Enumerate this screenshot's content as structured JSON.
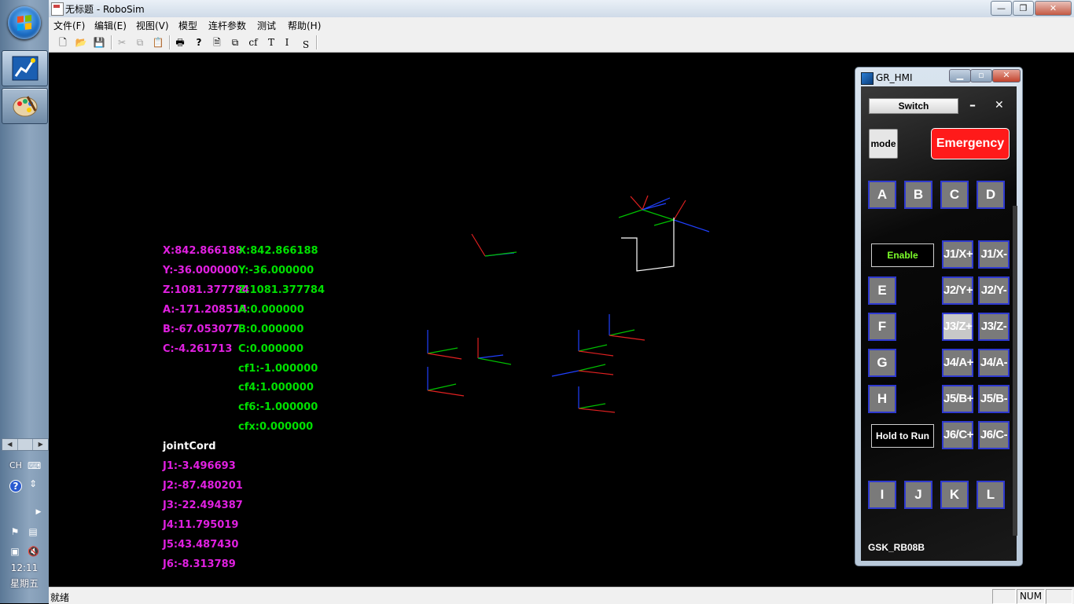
{
  "window": {
    "title": "无标题 - RoboSim",
    "controls": [
      "—",
      "❐",
      "✕"
    ]
  },
  "menu": [
    "文件(F)",
    "编辑(E)",
    "视图(V)",
    "模型",
    "连杆参数",
    "测试",
    "帮助(H)"
  ],
  "toolbar": {
    "new": "🗋",
    "open": "📂",
    "save": "💾",
    "cut": "✂",
    "copy": "⧉",
    "paste": "📋",
    "print": "🖶",
    "help": "?",
    "page": "🗎",
    "window": "⧉",
    "cf": "cf",
    "t": "T",
    "i": "I",
    "s": "S"
  },
  "viewport": {
    "cartesian_left": {
      "x": "X:842.866188",
      "y": "Y:-36.000000",
      "z": "Z:1081.377784",
      "a": "A:-171.208514",
      "b": "B:-67.053077",
      "c": "C:-4.261713"
    },
    "cartesian_right": {
      "x": "X:842.866188",
      "y": "Y:-36.000000",
      "z": "Z:1081.377784",
      "a": "A:0.000000",
      "b": "B:0.000000",
      "c": "C:0.000000",
      "cf1": "cf1:-1.000000",
      "cf4": "cf4:1.000000",
      "cf6": "cf6:-1.000000",
      "cfx": "cfx:0.000000"
    },
    "joint_header": "jointCord",
    "joints": [
      "J1:-3.496693",
      "J2:-87.480201",
      "J3:-22.494387",
      "J4:11.795019",
      "J5:43.487430",
      "J6:-8.313789"
    ]
  },
  "status": {
    "text": "就绪",
    "num": "NUM"
  },
  "hmi": {
    "title": "GR_HMI",
    "switch": "Switch",
    "minimize": "–",
    "close": "✕",
    "mode": "mode",
    "emergency": "Emergency",
    "top_buttons": [
      "A",
      "B",
      "C",
      "D"
    ],
    "enable": "Enable",
    "side_buttons": [
      "E",
      "F",
      "G",
      "H"
    ],
    "jog_plus": [
      "J1/X+",
      "J2/Y+",
      "J3/Z+",
      "J4/A+",
      "J5/B+",
      "J6/C+"
    ],
    "jog_minus": [
      "J1/X-",
      "J2/Y-",
      "J3/Z-",
      "J4/A-",
      "J5/B-",
      "J6/C-"
    ],
    "hold_to_run": "Hold to Run",
    "bottom_buttons": [
      "I",
      "J",
      "K",
      "L"
    ],
    "model": "GSK_RB08B"
  },
  "tray": {
    "lang": "CH",
    "time": "12:11",
    "day": "星期五"
  },
  "colors": {
    "magenta": "#e020e0",
    "green": "#00e000",
    "emergency": "#ff1a1a",
    "button_border": "#2f3ad0"
  }
}
